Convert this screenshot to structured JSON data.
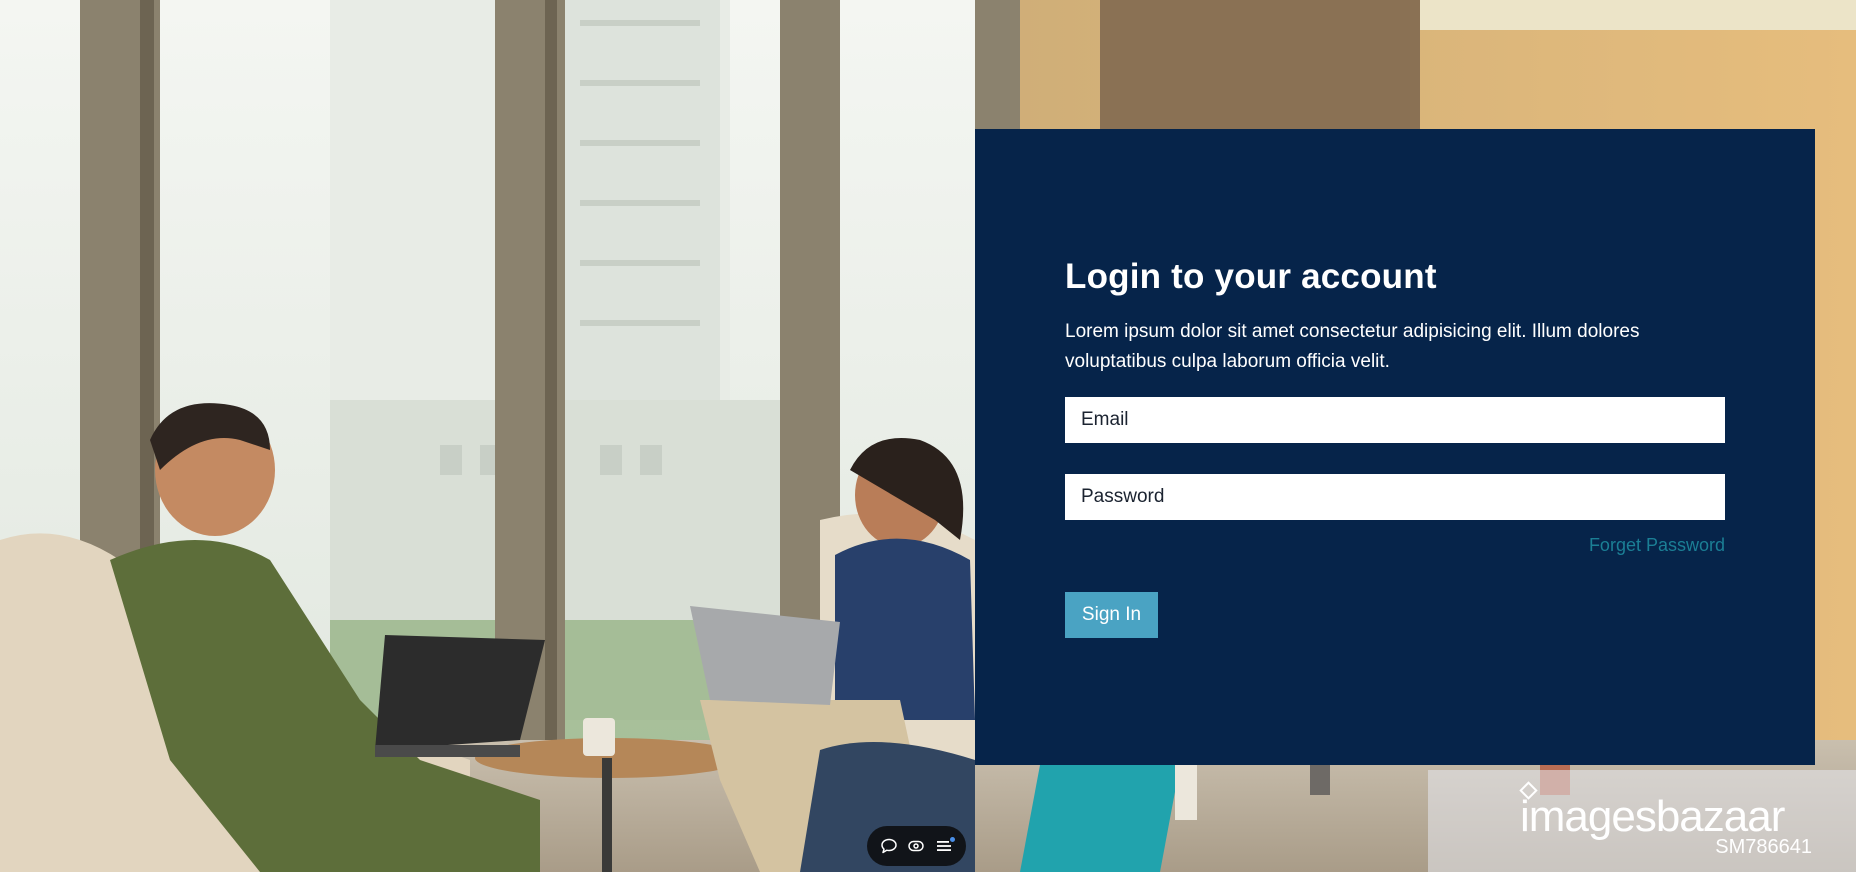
{
  "login": {
    "title": "Login to your account",
    "description": "Lorem ipsum dolor sit amet consectetur adipisicing elit. Illum dolores voluptatibus culpa laborum officia velit.",
    "email_placeholder": "Email",
    "password_placeholder": "Password",
    "forget_password_label": "Forget Password",
    "sign_in_label": "Sign In"
  },
  "watermark": {
    "brand": "imagesbazaar",
    "code": "SM786641"
  },
  "toolbar": {
    "items": [
      {
        "icon": "comment-icon"
      },
      {
        "icon": "eye-icon"
      },
      {
        "icon": "menu-icon"
      }
    ]
  },
  "colors": {
    "card_background": "#06244a",
    "sign_in_button": "#4aa3c3",
    "forget_link": "#1b7f95",
    "text": "#ffffff"
  }
}
